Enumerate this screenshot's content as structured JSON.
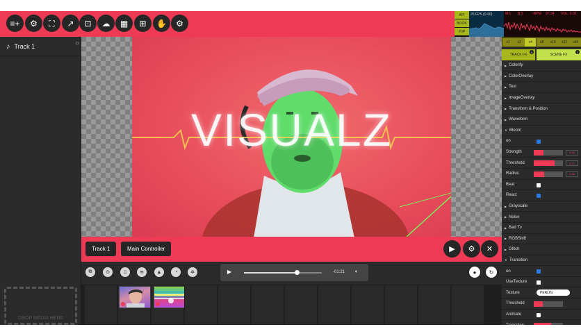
{
  "topbar": {
    "buttons": [
      {
        "name": "add-playlist-icon",
        "glyph": "≡+"
      },
      {
        "name": "settings-icon",
        "glyph": "⚙"
      },
      {
        "name": "fullscreen-icon",
        "glyph": "⛶"
      },
      {
        "name": "external-window-icon",
        "glyph": "↗"
      },
      {
        "name": "output-window-icon",
        "glyph": "⊡"
      },
      {
        "name": "cloud-icon",
        "glyph": "☁"
      },
      {
        "name": "grid-icon",
        "glyph": "▦"
      },
      {
        "name": "webcam-icon",
        "glyph": "⊞"
      },
      {
        "name": "hand-icon",
        "glyph": "✋"
      },
      {
        "name": "gear-icon",
        "glyph": "⚙"
      }
    ]
  },
  "monitor": {
    "modes": [
      "API",
      "BOOK",
      "PJP"
    ],
    "fps_label": "25 FPS (0-90)",
    "audio_labels": [
      "M:1",
      "B:3",
      "~BPM",
      "97.34",
      "VOL: 0.01"
    ]
  },
  "sidebar": {
    "track_label": "Track 1",
    "drop_label": "DROP MEDIA HERE"
  },
  "viewport": {
    "title_text": "VISUALZ"
  },
  "controlbar": {
    "track_button": "Track 1",
    "main_controller_button": "Main Controller"
  },
  "rightpanel": {
    "tabs": [
      "v1",
      "x2",
      "x4",
      "x8",
      "x16",
      "x32",
      "x64"
    ],
    "active_tab": 2,
    "track_fx_label": "TRACK FX",
    "track_fx_badge": "0",
    "scene_fx_label": "SCENE FX",
    "scene_fx_badge": "0",
    "effects": [
      {
        "type": "fx",
        "label": "Colorify"
      },
      {
        "type": "fx",
        "label": "ColorOverlay"
      },
      {
        "type": "fx",
        "label": "Text"
      },
      {
        "type": "fx",
        "label": "ImageOverlay"
      },
      {
        "type": "fx",
        "label": "Transform & Position"
      },
      {
        "type": "fx",
        "label": "Waveform"
      },
      {
        "type": "fx",
        "label": "Bloom",
        "open": true
      },
      {
        "type": "check",
        "label": "on",
        "checked": true
      },
      {
        "type": "slider",
        "label": "Strength",
        "fraction": 0.33,
        "value": "0.33"
      },
      {
        "type": "slider",
        "label": "Threshold",
        "fraction": 0.71,
        "value": "0.71"
      },
      {
        "type": "slider",
        "label": "Radius",
        "fraction": 0.36,
        "value": "0.36"
      },
      {
        "type": "check",
        "label": "Beat",
        "checked": false
      },
      {
        "type": "check",
        "label": "React",
        "checked": true
      },
      {
        "type": "fx",
        "label": "Grayscale"
      },
      {
        "type": "fx",
        "label": "Noise"
      },
      {
        "type": "fx",
        "label": "Bad Tv"
      },
      {
        "type": "fx",
        "label": "RGBShift"
      },
      {
        "type": "fx",
        "label": "Glitch"
      },
      {
        "type": "fx",
        "label": "Transition",
        "open": true
      },
      {
        "type": "check",
        "label": "on",
        "checked": true
      },
      {
        "type": "check",
        "label": "UseTexture",
        "checked": false
      },
      {
        "type": "select",
        "label": "Texture",
        "value": "PERLIN"
      },
      {
        "type": "slider",
        "label": "Threshold",
        "fraction": 0.3,
        "value": ""
      },
      {
        "type": "check",
        "label": "Animate",
        "checked": false
      },
      {
        "type": "slider",
        "label": "Transition",
        "fraction": 0.6,
        "value": ""
      }
    ]
  },
  "bottom": {
    "toolbar_icons": [
      "layers-icon",
      "record-icon",
      "device-icon",
      "waveform-icon",
      "mountain-icon",
      "clock-icon",
      "snowflake-icon"
    ],
    "player_time": "-01:21",
    "progress_fraction": 0.68,
    "right_buttons": [
      "circle-icon",
      "refresh-icon"
    ]
  },
  "colors": {
    "accent": "#ee3a54",
    "panel": "#2b2b2b",
    "tab_active": "#c2cc28"
  }
}
